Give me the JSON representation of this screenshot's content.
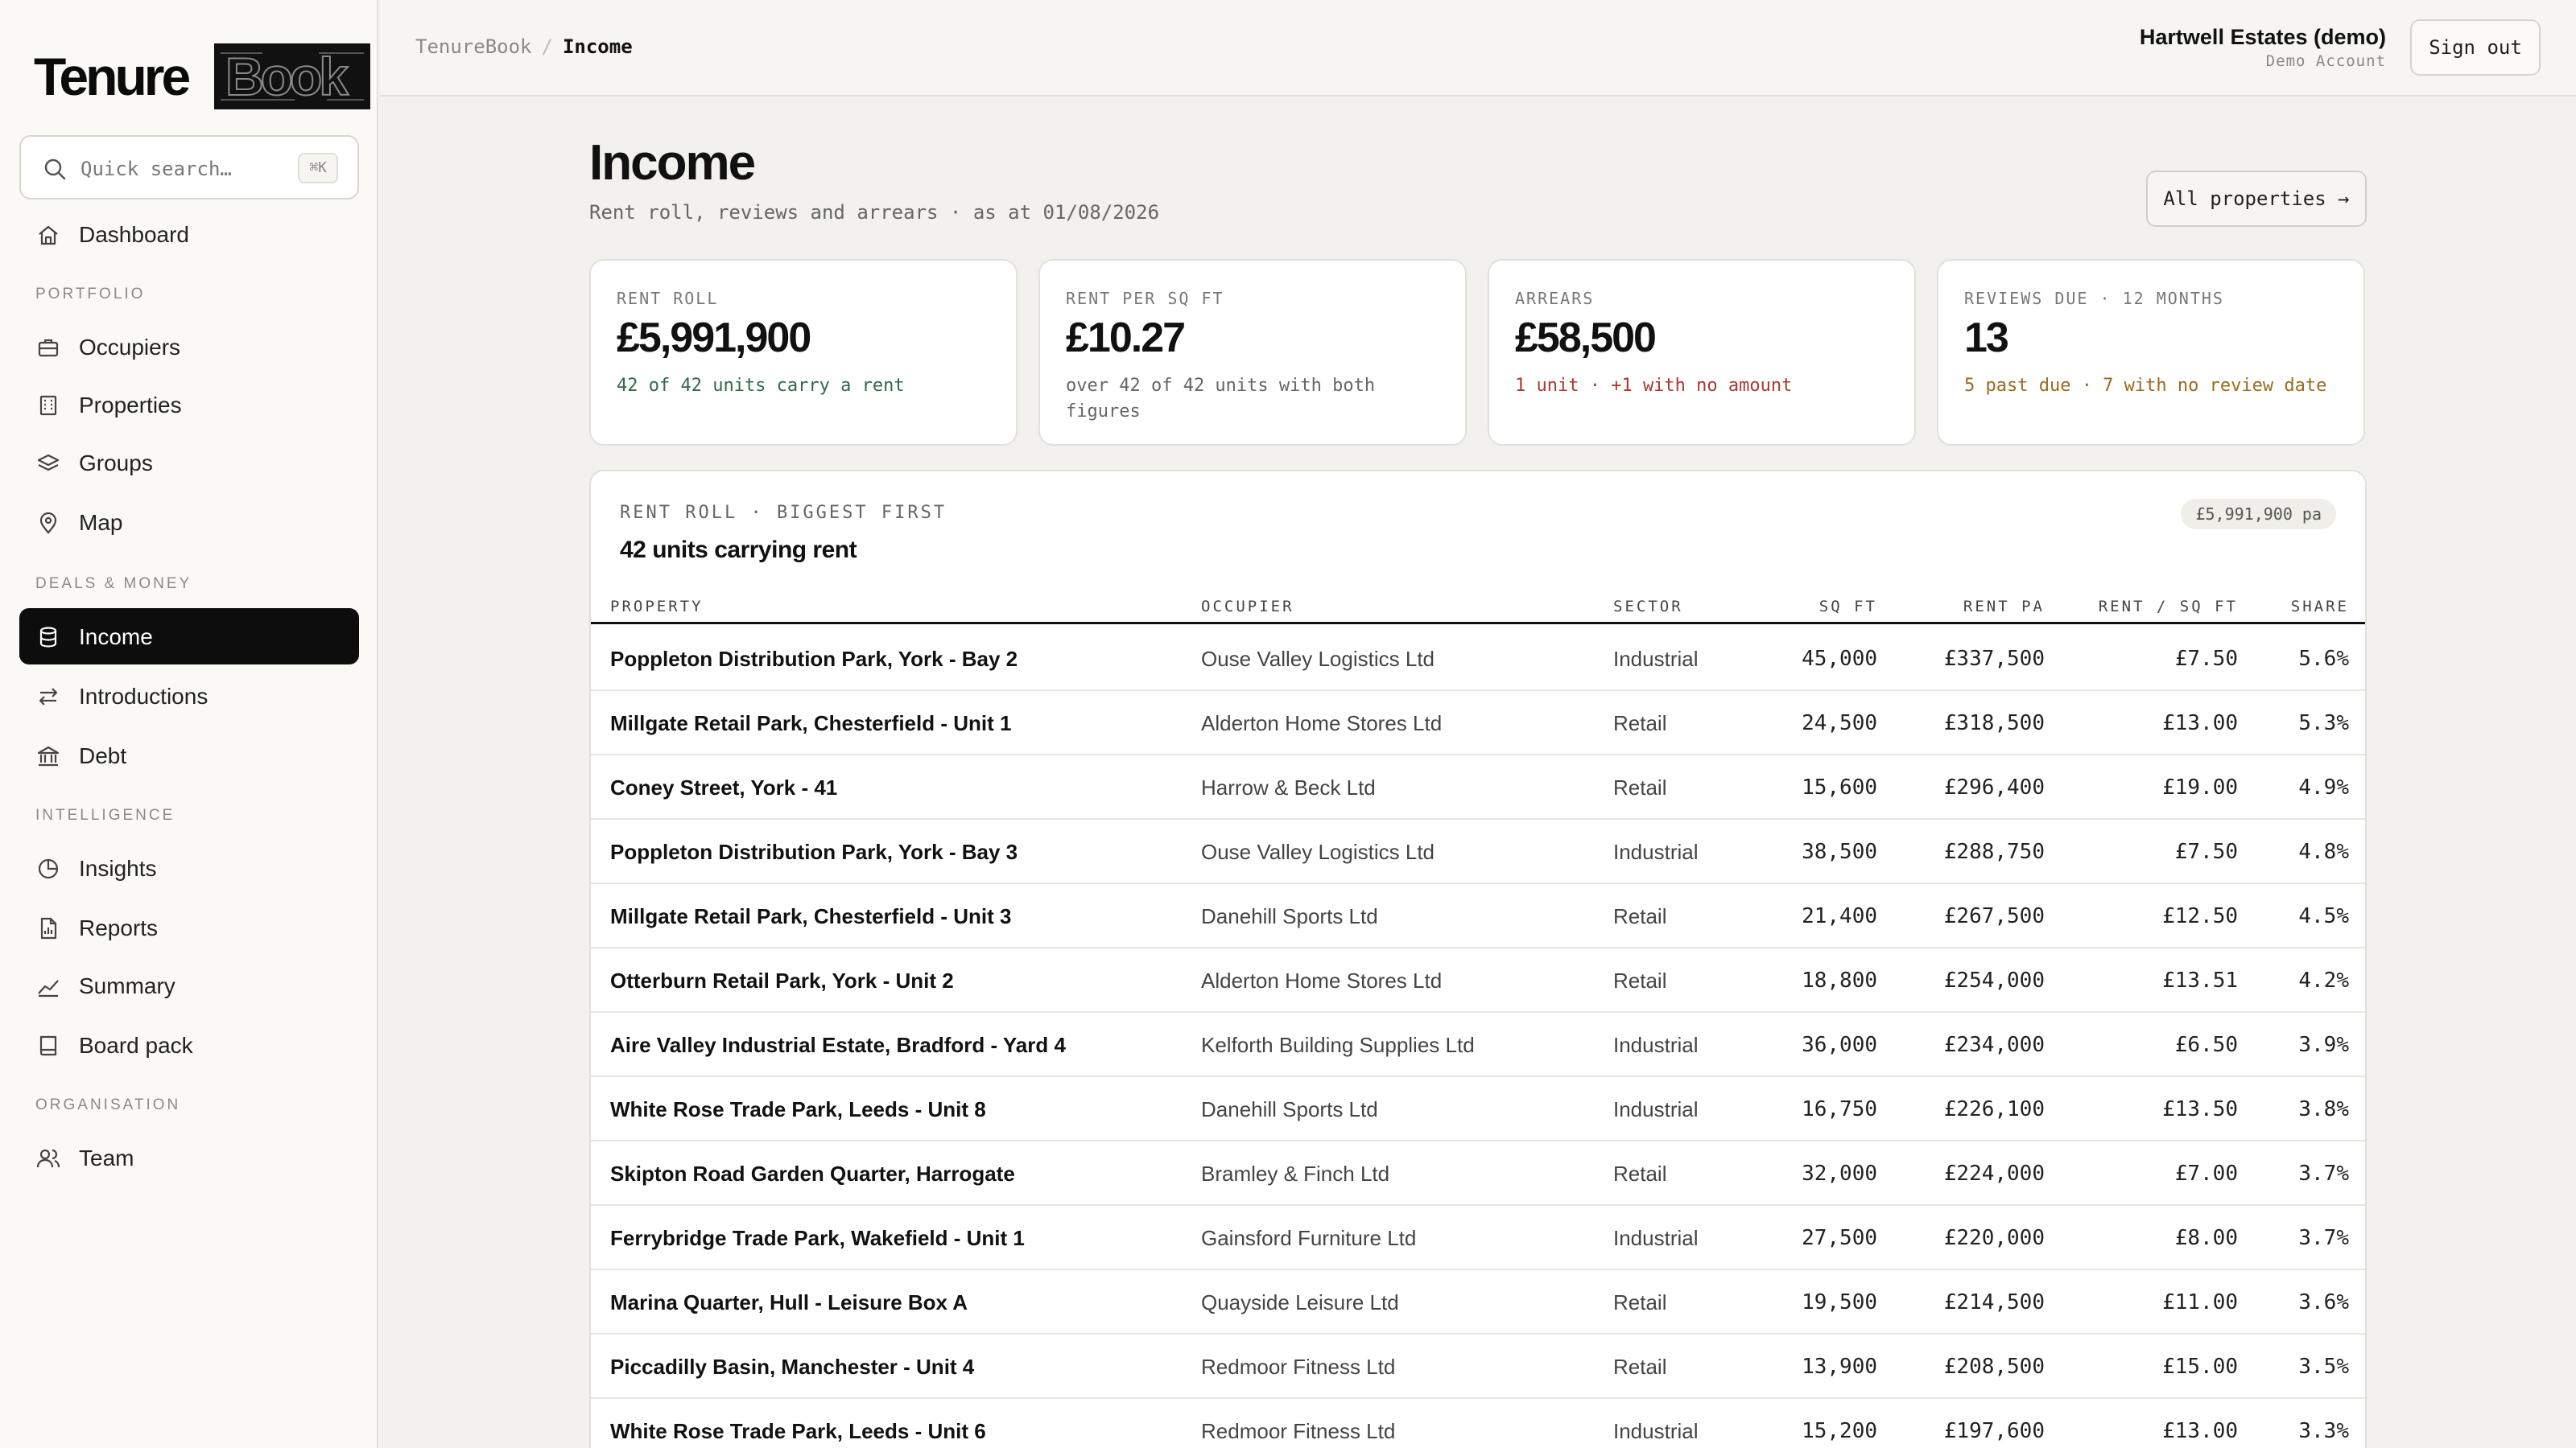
{
  "app": {
    "logo_text": "TenureBook"
  },
  "sidebar": {
    "search_placeholder": "Quick search…",
    "search_shortcut": "⌘K",
    "dashboard": "Dashboard",
    "sections": {
      "portfolio": "PORTFOLIO",
      "deals": "DEALS & MONEY",
      "intelligence": "INTELLIGENCE",
      "organisation": "ORGANISATION"
    },
    "items": {
      "occupiers": "Occupiers",
      "properties": "Properties",
      "groups": "Groups",
      "map": "Map",
      "income": "Income",
      "introductions": "Introductions",
      "debt": "Debt",
      "insights": "Insights",
      "reports": "Reports",
      "summary": "Summary",
      "board_pack": "Board pack",
      "team": "Team"
    }
  },
  "topbar": {
    "breadcrumb_root": "TenureBook",
    "breadcrumb_sep": "/",
    "breadcrumb_current": "Income",
    "account_name": "Hartwell Estates (demo)",
    "account_sub": "Demo Account",
    "signout": "Sign out"
  },
  "page": {
    "title": "Income",
    "subtitle": "Rent roll, reviews and arrears · as at 01/08/2026",
    "all_properties": "All properties →"
  },
  "cards": [
    {
      "key": "RENT ROLL",
      "value": "£5,991,900",
      "note": "42 of 42 units carry a rent",
      "tone": "green"
    },
    {
      "key": "RENT PER SQ FT",
      "value": "£10.27",
      "note": "over 42 of 42 units with both figures",
      "tone": "grey"
    },
    {
      "key": "ARREARS",
      "value": "£58,500",
      "note": "1 unit · +1 with no amount",
      "tone": "red"
    },
    {
      "key": "REVIEWS DUE · 12 MONTHS",
      "value": "13",
      "note": "5 past due · 7 with no review date",
      "tone": "amber"
    }
  ],
  "table": {
    "kicker": "RENT ROLL · BIGGEST FIRST",
    "title": "42 units carrying rent",
    "pill": "£5,991,900 pa",
    "columns": {
      "property": "PROPERTY",
      "occupier": "OCCUPIER",
      "sector": "SECTOR",
      "sqft": "SQ FT",
      "rent": "RENT PA",
      "rent_sqft": "RENT / SQ FT",
      "share": "SHARE"
    },
    "rows": [
      {
        "property": "Poppleton Distribution Park, York - Bay 2",
        "occupier": "Ouse Valley Logistics Ltd",
        "sector": "Industrial",
        "sqft": "45,000",
        "rent": "£337,500",
        "rent_sqft": "£7.50",
        "share": "5.6%"
      },
      {
        "property": "Millgate Retail Park, Chesterfield - Unit 1",
        "occupier": "Alderton Home Stores Ltd",
        "sector": "Retail",
        "sqft": "24,500",
        "rent": "£318,500",
        "rent_sqft": "£13.00",
        "share": "5.3%"
      },
      {
        "property": "Coney Street, York - 41",
        "occupier": "Harrow & Beck Ltd",
        "sector": "Retail",
        "sqft": "15,600",
        "rent": "£296,400",
        "rent_sqft": "£19.00",
        "share": "4.9%"
      },
      {
        "property": "Poppleton Distribution Park, York - Bay 3",
        "occupier": "Ouse Valley Logistics Ltd",
        "sector": "Industrial",
        "sqft": "38,500",
        "rent": "£288,750",
        "rent_sqft": "£7.50",
        "share": "4.8%"
      },
      {
        "property": "Millgate Retail Park, Chesterfield - Unit 3",
        "occupier": "Danehill Sports Ltd",
        "sector": "Retail",
        "sqft": "21,400",
        "rent": "£267,500",
        "rent_sqft": "£12.50",
        "share": "4.5%"
      },
      {
        "property": "Otterburn Retail Park, York - Unit 2",
        "occupier": "Alderton Home Stores Ltd",
        "sector": "Retail",
        "sqft": "18,800",
        "rent": "£254,000",
        "rent_sqft": "£13.51",
        "share": "4.2%"
      },
      {
        "property": "Aire Valley Industrial Estate, Bradford - Yard 4",
        "occupier": "Kelforth Building Supplies Ltd",
        "sector": "Industrial",
        "sqft": "36,000",
        "rent": "£234,000",
        "rent_sqft": "£6.50",
        "share": "3.9%"
      },
      {
        "property": "White Rose Trade Park, Leeds - Unit 8",
        "occupier": "Danehill Sports Ltd",
        "sector": "Industrial",
        "sqft": "16,750",
        "rent": "£226,100",
        "rent_sqft": "£13.50",
        "share": "3.8%"
      },
      {
        "property": "Skipton Road Garden Quarter, Harrogate",
        "occupier": "Bramley & Finch Ltd",
        "sector": "Retail",
        "sqft": "32,000",
        "rent": "£224,000",
        "rent_sqft": "£7.00",
        "share": "3.7%"
      },
      {
        "property": "Ferrybridge Trade Park, Wakefield - Unit 1",
        "occupier": "Gainsford Furniture Ltd",
        "sector": "Industrial",
        "sqft": "27,500",
        "rent": "£220,000",
        "rent_sqft": "£8.00",
        "share": "3.7%"
      },
      {
        "property": "Marina Quarter, Hull - Leisure Box A",
        "occupier": "Quayside Leisure Ltd",
        "sector": "Retail",
        "sqft": "19,500",
        "rent": "£214,500",
        "rent_sqft": "£11.00",
        "share": "3.6%"
      },
      {
        "property": "Piccadilly Basin, Manchester - Unit 4",
        "occupier": "Redmoor Fitness Ltd",
        "sector": "Retail",
        "sqft": "13,900",
        "rent": "£208,500",
        "rent_sqft": "£15.00",
        "share": "3.5%"
      },
      {
        "property": "White Rose Trade Park, Leeds - Unit 6",
        "occupier": "Redmoor Fitness Ltd",
        "sector": "Industrial",
        "sqft": "15,200",
        "rent": "£197,600",
        "rent_sqft": "£13.00",
        "share": "3.3%"
      }
    ]
  },
  "icons": {
    "search": "search-icon",
    "dashboard": "home-icon",
    "occupiers": "briefcase-icon",
    "properties": "building-icon",
    "groups": "layers-icon",
    "map": "map-pin-icon",
    "income": "database-icon",
    "introductions": "arrows-exchange-icon",
    "debt": "bank-icon",
    "insights": "pie-chart-icon",
    "reports": "report-file-icon",
    "summary": "trend-line-icon",
    "board_pack": "book-icon",
    "team": "users-icon"
  }
}
